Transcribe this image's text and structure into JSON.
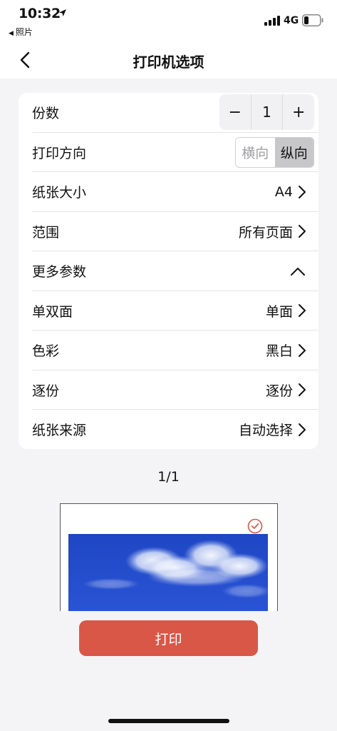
{
  "status_bar": {
    "time": "10:32",
    "back_app": "照片",
    "network": "4G"
  },
  "nav": {
    "title": "打印机选项"
  },
  "settings": {
    "copies": {
      "label": "份数",
      "minus": "−",
      "value": "1",
      "plus": "+"
    },
    "orientation": {
      "label": "打印方向",
      "landscape": "横向",
      "portrait": "纵向",
      "selected": "纵向"
    },
    "paper_size": {
      "label": "纸张大小",
      "value": "A4"
    },
    "range": {
      "label": "范围",
      "value": "所有页面"
    },
    "more": {
      "label": "更多参数"
    },
    "duplex": {
      "label": "单双面",
      "value": "单面"
    },
    "color": {
      "label": "色彩",
      "value": "黑白"
    },
    "collate": {
      "label": "逐份",
      "value": "逐份"
    },
    "paper_source": {
      "label": "纸张来源",
      "value": "自动选择"
    }
  },
  "preview": {
    "page_indicator": "1/1",
    "selected": true,
    "accent_color": "#d95747"
  },
  "print_button": {
    "label": "打印",
    "color": "#d95747"
  },
  "icons": [
    "location-arrow-icon",
    "signal-icon",
    "battery-icon",
    "back-chevron-icon",
    "chevron-right-icon",
    "chevron-up-icon",
    "check-circle-icon"
  ]
}
